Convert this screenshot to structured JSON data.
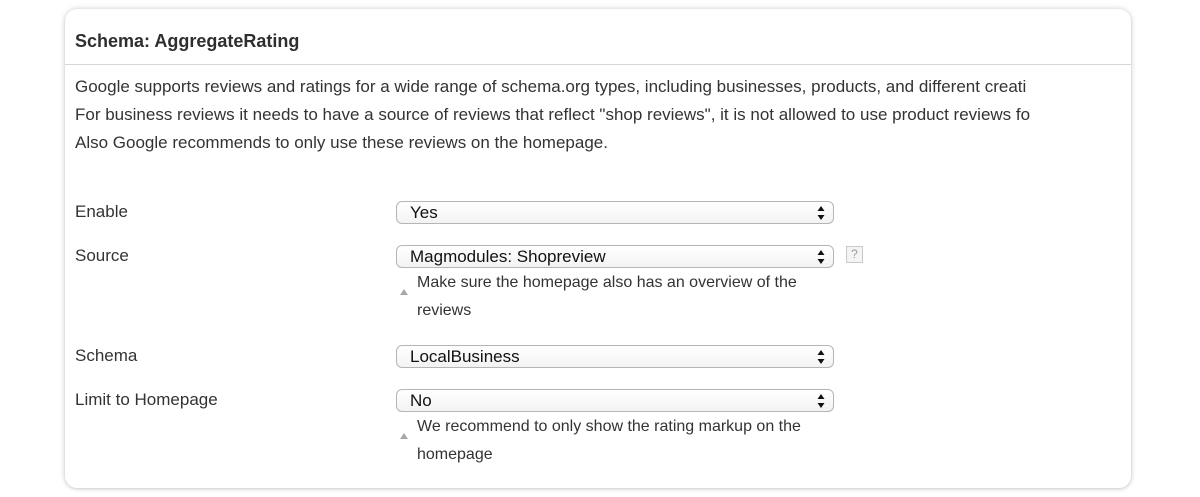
{
  "section": {
    "title": "Schema: AggregateRating",
    "description": [
      "Google supports reviews and ratings for a wide range of schema.org types, including businesses, products, and different creati",
      "For business reviews it needs to have a source of reviews that reflect \"shop reviews\", it is not allowed to use product reviews fo",
      "Also Google recommends to only use these reviews on the homepage."
    ]
  },
  "fields": {
    "enable": {
      "label": "Enable",
      "value": "Yes"
    },
    "source": {
      "label": "Source",
      "value": "Magmodules: Shopreview",
      "help_icon": "?",
      "note": [
        "Make sure the homepage also has an overview of the",
        "reviews"
      ]
    },
    "schema": {
      "label": "Schema",
      "value": "LocalBusiness"
    },
    "limit": {
      "label": "Limit to Homepage",
      "value": "No",
      "note": [
        "We recommend to only show the rating markup on the",
        "homepage"
      ]
    }
  },
  "icons": {
    "select_arrows": "up-down-arrows-icon",
    "note_marker": "triangle-up-icon",
    "help": "question-mark-icon"
  }
}
